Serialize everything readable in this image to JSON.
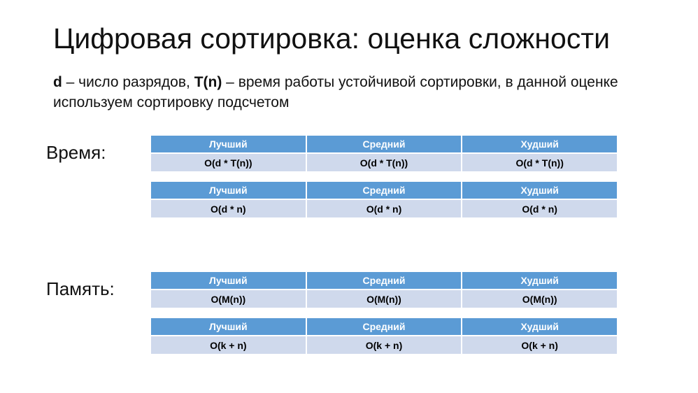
{
  "slide": {
    "title": "Цифровая сортировка: оценка сложности",
    "note": {
      "d_bold": "d",
      "part1": " – число разрядов, ",
      "tn_bold": "T(n)",
      "part2": " – время работы устойчивой сортировки, в данной оценке используем сортировку подсчетом"
    }
  },
  "sections": {
    "time": {
      "label": "Время:",
      "table1": {
        "headers": [
          "Лучший",
          "Средний",
          "Худший"
        ],
        "values": [
          "O(d * T(n))",
          "O(d * T(n))",
          "O(d * T(n))"
        ]
      },
      "table2": {
        "headers": [
          "Лучший",
          "Средний",
          "Худший"
        ],
        "values": [
          "O(d * n)",
          "O(d * n)",
          "O(d * n)"
        ]
      }
    },
    "memory": {
      "label": "Память:",
      "table1": {
        "headers": [
          "Лучший",
          "Средний",
          "Худший"
        ],
        "values": [
          "O(M(n))",
          "O(M(n))",
          "O(M(n))"
        ]
      },
      "table2": {
        "headers": [
          "Лучший",
          "Средний",
          "Худший"
        ],
        "values": [
          "O(k + n)",
          "O(k + n)",
          "O(k + n)"
        ]
      }
    }
  },
  "colors": {
    "header_bg": "#5b9bd5",
    "row_bg": "#cfd9ec",
    "header_text": "#ffffff"
  }
}
